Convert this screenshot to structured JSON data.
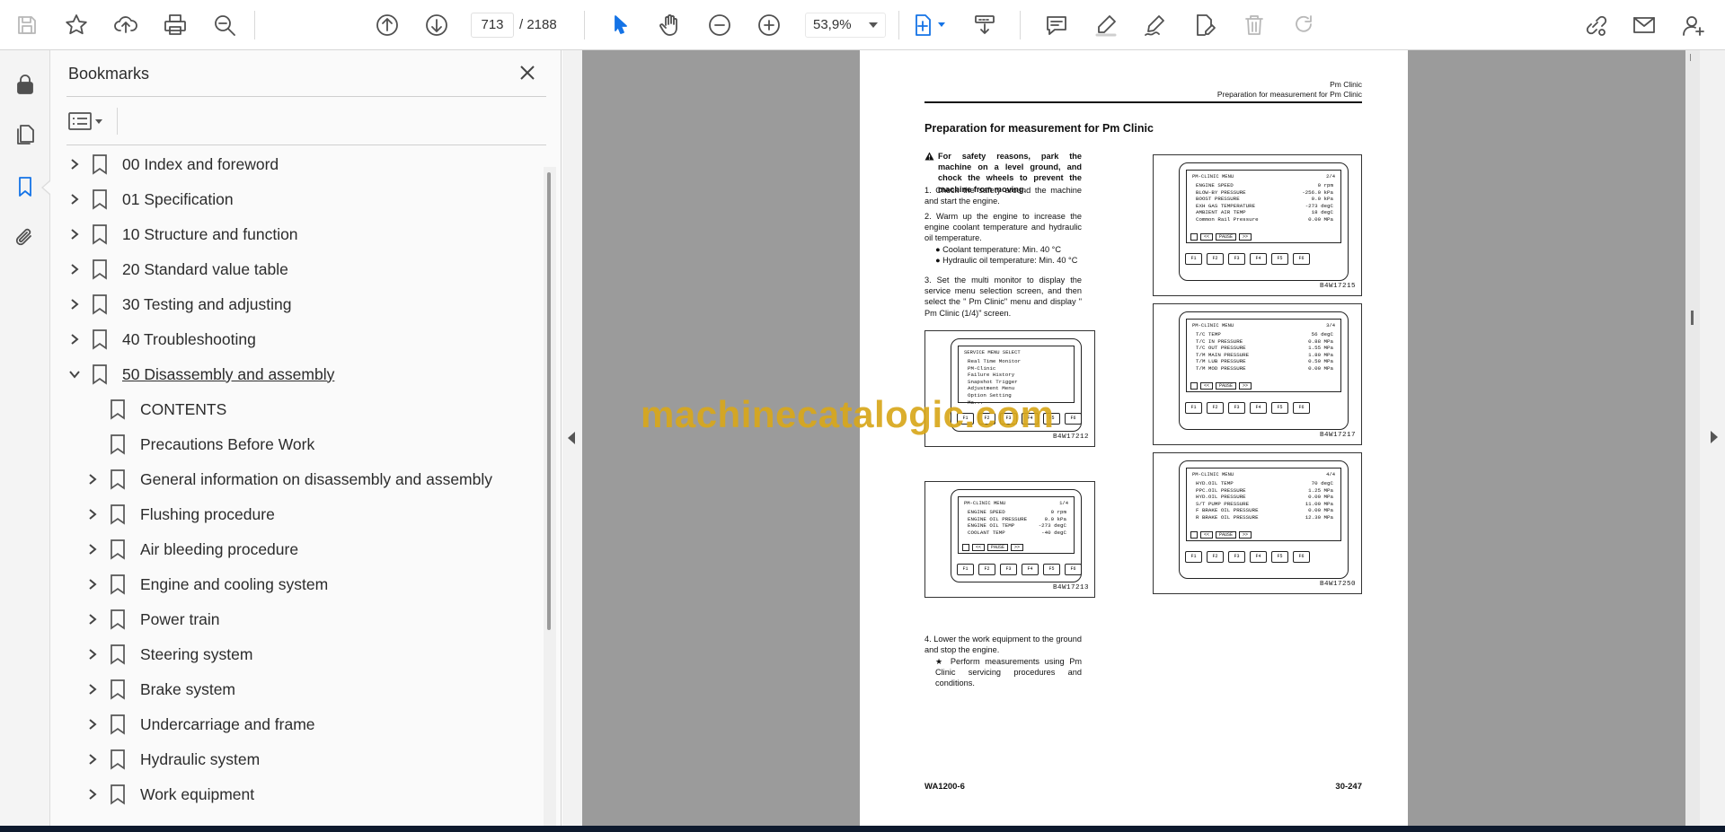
{
  "toolbar": {
    "current_page": "713",
    "total_pages": "/ 2188",
    "zoom": "53,9%",
    "icons": [
      "save-icon",
      "star-icon",
      "upload-icon",
      "print-icon",
      "zoom-search-icon",
      "page-up-icon",
      "page-down-icon",
      "select-cursor-icon",
      "hand-icon",
      "zoom-out-icon",
      "zoom-in-icon",
      "fit-page-icon",
      "scroll-mode-icon",
      "comment-icon",
      "highlight-icon",
      "sign-icon",
      "fill-sign-icon",
      "delete-icon",
      "redo-icon",
      "share-link-icon",
      "email-icon",
      "add-user-icon"
    ]
  },
  "rail": {
    "icons": [
      "lock-icon",
      "pages-icon",
      "bookmark-icon",
      "attachment-icon"
    ]
  },
  "bookmarks": {
    "title": "Bookmarks",
    "items": [
      {
        "label": "00 Index and foreword",
        "level": 0,
        "state": "collapsed"
      },
      {
        "label": "01 Specification",
        "level": 0,
        "state": "collapsed"
      },
      {
        "label": "10 Structure and function",
        "level": 0,
        "state": "collapsed"
      },
      {
        "label": "20 Standard value table",
        "level": 0,
        "state": "collapsed"
      },
      {
        "label": "30 Testing and adjusting",
        "level": 0,
        "state": "collapsed"
      },
      {
        "label": "40 Troubleshooting",
        "level": 0,
        "state": "collapsed"
      },
      {
        "label": "50 Disassembly and assembly",
        "level": 0,
        "state": "expanded"
      },
      {
        "label": "CONTENTS",
        "level": 1,
        "state": "leaf"
      },
      {
        "label": "Precautions Before Work",
        "level": 1,
        "state": "leaf"
      },
      {
        "label": "General information on disassembly and assembly",
        "level": 1,
        "state": "collapsed"
      },
      {
        "label": "Flushing procedure",
        "level": 1,
        "state": "collapsed"
      },
      {
        "label": "Air bleeding procedure",
        "level": 1,
        "state": "collapsed"
      },
      {
        "label": "Engine and cooling system",
        "level": 1,
        "state": "collapsed"
      },
      {
        "label": "Power train",
        "level": 1,
        "state": "collapsed"
      },
      {
        "label": "Steering system",
        "level": 1,
        "state": "collapsed"
      },
      {
        "label": "Brake system",
        "level": 1,
        "state": "collapsed"
      },
      {
        "label": "Undercarriage and frame",
        "level": 1,
        "state": "collapsed"
      },
      {
        "label": "Hydraulic system",
        "level": 1,
        "state": "collapsed"
      },
      {
        "label": "Work equipment",
        "level": 1,
        "state": "collapsed"
      }
    ]
  },
  "document": {
    "header_1": "Pm Clinic",
    "header_2": "Preparation for measurement for Pm Clinic",
    "title": "Preparation for measurement for Pm Clinic",
    "warning": "For safety reasons, park the machine on a level ground, and chock the wheels to prevent the machine from moving.",
    "step1": "1.  Check the safety around the machine and start the engine.",
    "step2": "2.  Warm up the engine to increase the engine coolant temperature and hydraulic oil temperature.",
    "bullet1": "●  Coolant temperature: Min. 40 °C",
    "bullet2": "●  Hydraulic oil temperature: Min. 40 °C",
    "step3": "3.  Set the multi monitor to display the service menu selection screen, and then select the \" Pm Clinic\" menu and display \" Pm Clinic (1/4)\" screen.",
    "step4": "4.  Lower the work equipment to the ground and stop the engine.",
    "star_note": "★  Perform measurements using Pm Clinic servicing procedures and conditions.",
    "footer_left": "WA1200-6",
    "footer_right": "30-247",
    "watermark": "machinecatalogic.com",
    "figures": [
      {
        "code": "B4W17212",
        "title": "SERVICE MENU SELECT",
        "page": "",
        "rows": [
          [
            "Real Time Monitor",
            ""
          ],
          [
            "PM-Clinic",
            ""
          ],
          [
            "Failure History",
            ""
          ],
          [
            "Snapshot Trigger",
            ""
          ],
          [
            "Adjustment Menu",
            ""
          ],
          [
            "Option Setting",
            ""
          ],
          [
            "Ma...",
            ""
          ]
        ]
      },
      {
        "code": "B4W17213",
        "title": "PM-CLINIC MENU",
        "page": "1/4",
        "rows": [
          [
            "ENGINE SPEED",
            "0  rpm"
          ],
          [
            "ENGINE OIL PRESSURE",
            "0.0  kPa"
          ],
          [
            "ENGINE OIL TEMP",
            "-273  degC"
          ],
          [
            "COOLANT TEMP",
            "-40  degC"
          ]
        ]
      },
      {
        "code": "B4W17215",
        "title": "PM-CLINIC MENU",
        "page": "2/4",
        "rows": [
          [
            "ENGINE SPEED",
            "0  rpm"
          ],
          [
            "BLOW-BY PRESSURE",
            "-256.0  kPa"
          ],
          [
            "BOOST PRESSURE",
            "0.0  kPa"
          ],
          [
            "EXH GAS TEMPERATURE",
            "-273  degC"
          ],
          [
            "AMBIENT AIR TEMP",
            "18  degC"
          ],
          [
            "Common Rail Pressure",
            "0.00  MPa"
          ]
        ]
      },
      {
        "code": "B4W17217",
        "title": "PM-CLINIC MENU",
        "page": "3/4",
        "rows": [
          [
            "T/C TEMP",
            "56  degC"
          ],
          [
            "T/C IN PRESSURE",
            "0.88  MPa"
          ],
          [
            "T/C OUT PRESSURE",
            "1.55  MPa"
          ],
          [
            "T/M MAIN PRESSURE",
            "1.80  MPa"
          ],
          [
            "T/M LUB PRESSURE",
            "0.50  MPa"
          ],
          [
            "T/M MOD PRESSURE",
            "0.00  MPa"
          ]
        ]
      },
      {
        "code": "B4W17250",
        "title": "PM-CLINIC MENU",
        "page": "4/4",
        "rows": [
          [
            "HYD.OIL TEMP",
            "70  degC"
          ],
          [
            "PPC.OIL PRESSURE",
            "1.25  MPa"
          ],
          [
            "HYD.OIL PRESSURE",
            "0.00  MPa"
          ],
          [
            "S/T PUMP PRESSURE",
            "11.00  MPa"
          ],
          [
            "F BRAKE OIL PRESSURE",
            "0.00  MPa"
          ],
          [
            "R BRAKE OIL PRESSURE",
            "12.30  MPa"
          ]
        ]
      }
    ],
    "fkeys": [
      "F1",
      "F2",
      "F3",
      "F4",
      "F5",
      "F6"
    ],
    "screen_tabs": [
      "",
      "<<",
      "PAUSE",
      ">>"
    ]
  }
}
